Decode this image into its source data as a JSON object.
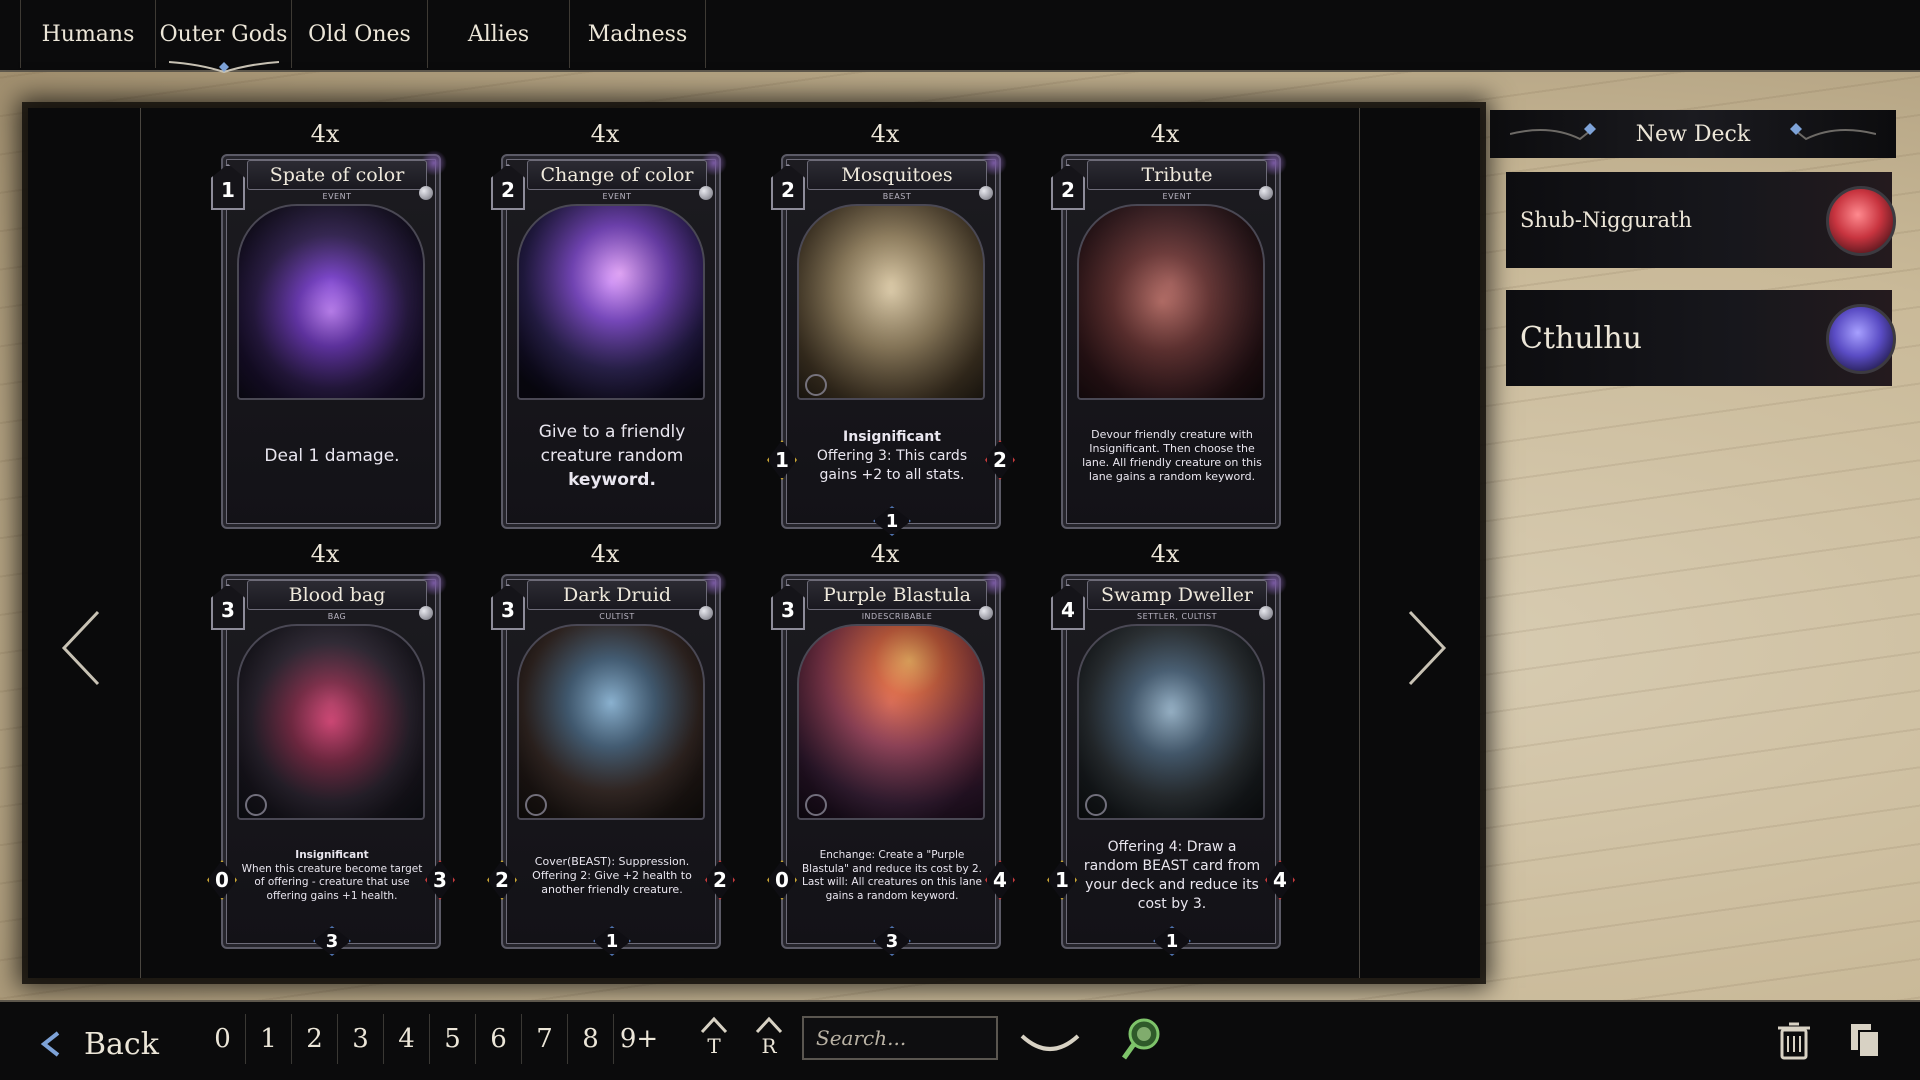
{
  "tabs": [
    {
      "label": "Humans"
    },
    {
      "label": "Outer Gods",
      "active": true
    },
    {
      "label": "Old Ones"
    },
    {
      "label": "Allies"
    },
    {
      "label": "Madness"
    }
  ],
  "cards": [
    {
      "count": "4x",
      "name": "Spate of color",
      "cost": "1",
      "type": "EVENT",
      "art": "purple",
      "text": [
        {
          "t": "Deal 1 damage.",
          "bold": false
        }
      ]
    },
    {
      "count": "4x",
      "name": "Change of color",
      "cost": "2",
      "type": "EVENT",
      "art": "swirl",
      "text": [
        {
          "t": "Give to a friendly creature random",
          "bold": false
        },
        {
          "t": "keyword.",
          "bold": true
        }
      ]
    },
    {
      "count": "4x",
      "name": "Mosquitoes",
      "cost": "2",
      "type": "BEAST",
      "art": "mosq",
      "text": [
        {
          "t": "Insignificant",
          "bold": true
        },
        {
          "t": "Offering 3: This cards gains +2 to all stats.",
          "bold": false
        }
      ],
      "attack": "1",
      "health": "2",
      "rank": "1"
    },
    {
      "count": "4x",
      "name": "Tribute",
      "cost": "2",
      "type": "EVENT",
      "art": "tribute",
      "text": [
        {
          "t": "Devour friendly creature with Insignificant. Then choose the lane. All friendly creature on this lane gains a random keyword.",
          "bold": false
        }
      ]
    },
    {
      "count": "4x",
      "name": "Blood bag",
      "cost": "3",
      "type": "BAG",
      "art": "blood",
      "text": [
        {
          "t": "Insignificant",
          "bold": true
        },
        {
          "t": "When this creature become target of offering - creature that use offering gains +1 health.",
          "bold": false
        }
      ],
      "attack": "0",
      "health": "3",
      "rank": "3"
    },
    {
      "count": "4x",
      "name": "Dark Druid",
      "cost": "3",
      "type": "CULTIST",
      "art": "druid",
      "text": [
        {
          "t": "Cover(BEAST): Suppression.",
          "bold": false
        },
        {
          "t": "Offering 2: Give +2 health to another friendly creature.",
          "bold": false
        }
      ],
      "attack": "2",
      "health": "2",
      "rank": "1"
    },
    {
      "count": "4x",
      "name": "Purple Blastula",
      "cost": "3",
      "type": "INDESCRIBABLE",
      "art": "blastula",
      "text": [
        {
          "t": "Enchange: Create a \"Purple Blastula\" and reduce its cost by 2.",
          "bold": false
        },
        {
          "t": "Last will: All creatures on this lane gains a random keyword.",
          "bold": false
        }
      ],
      "attack": "0",
      "health": "4",
      "rank": "3"
    },
    {
      "count": "4x",
      "name": "Swamp Dweller",
      "cost": "4",
      "type": "SETTLER, CULTIST",
      "art": "swamp",
      "text": [
        {
          "t": "Offering 4: Draw a random BEAST card from your deck and reduce its cost by 3.",
          "bold": false
        }
      ],
      "attack": "1",
      "health": "4",
      "rank": "1"
    }
  ],
  "deck_panel": {
    "new_deck_label": "New Deck",
    "decks": [
      {
        "name": "Shub-Niggurath",
        "avatar_color": "#c8343f"
      },
      {
        "name": "Cthulhu",
        "avatar_color": "#5a4cc4"
      }
    ]
  },
  "bottom": {
    "back_label": "Back",
    "cost_filters": [
      "0",
      "1",
      "2",
      "3",
      "4",
      "5",
      "6",
      "7",
      "8",
      "9+"
    ],
    "sort_type_label": "T",
    "sort_rarity_label": "R",
    "search_placeholder": "Search..."
  },
  "colors": {
    "attack": "#c9a534",
    "health": "#c73b3b",
    "rank": "#4f73b0"
  }
}
